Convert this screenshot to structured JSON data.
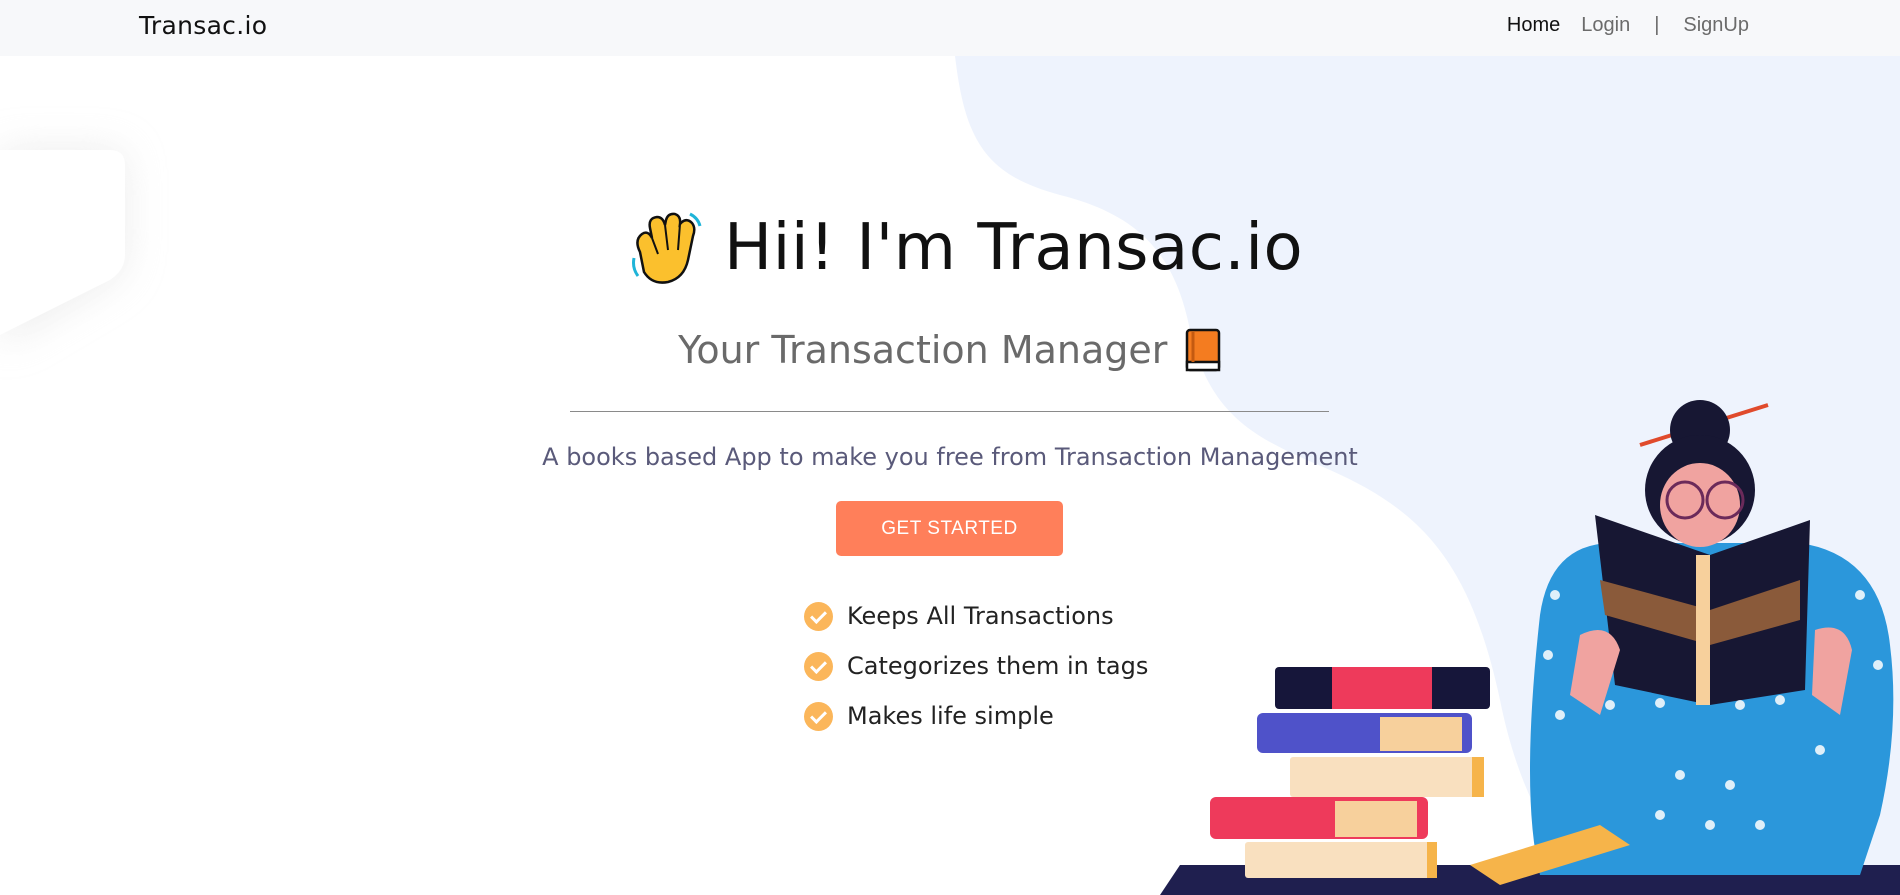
{
  "nav": {
    "brand": "Transac.io",
    "home": "Home",
    "login": "Login",
    "separator": "|",
    "signup": "SignUp"
  },
  "hero": {
    "title": "Hii! I'm Transac.io",
    "title_icon": "waving-hand-icon",
    "subtitle": "Your Transaction Manager",
    "subtitle_icon": "orange-book-icon",
    "tagline": "A books based App to make you free from Transaction Management",
    "cta": "GET STARTED",
    "features": [
      "Keeps All Transactions",
      "Categorizes them in tags",
      "Makes life simple"
    ]
  },
  "illustration": "woman-reading-book-illustration",
  "colors": {
    "accent": "#ff7f5a",
    "check": "#fbb65a",
    "navbar_bg": "#f7f8fa",
    "blob_bg": "#eef3fd"
  }
}
